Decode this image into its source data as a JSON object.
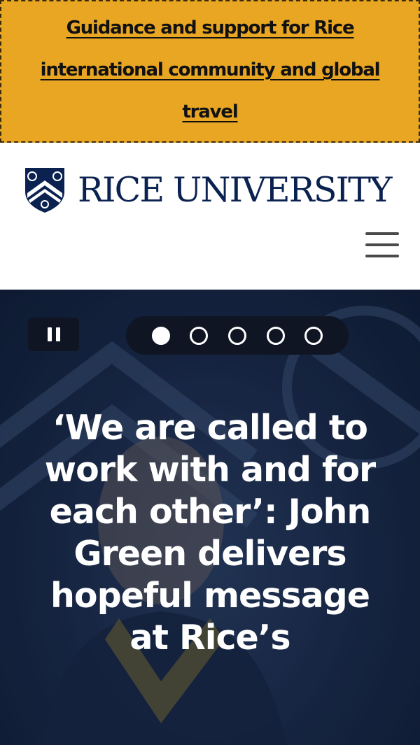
{
  "alert": {
    "link_text": "Guidance and support for Rice international community and global travel"
  },
  "header": {
    "wordmark": "RICE UNIVERSITY",
    "logo_icon": "rice-shield-icon",
    "menu_icon": "hamburger-menu-icon"
  },
  "hero": {
    "pause_icon": "pause-icon",
    "slide_count": 5,
    "active_slide": 1,
    "headline": "‘We are called to work with and for each other’: John Green delivers hopeful message at Rice’s"
  },
  "colors": {
    "alert_background": "#e8a623",
    "brand_navy": "#0b2251",
    "control_background": "#0f1523"
  }
}
